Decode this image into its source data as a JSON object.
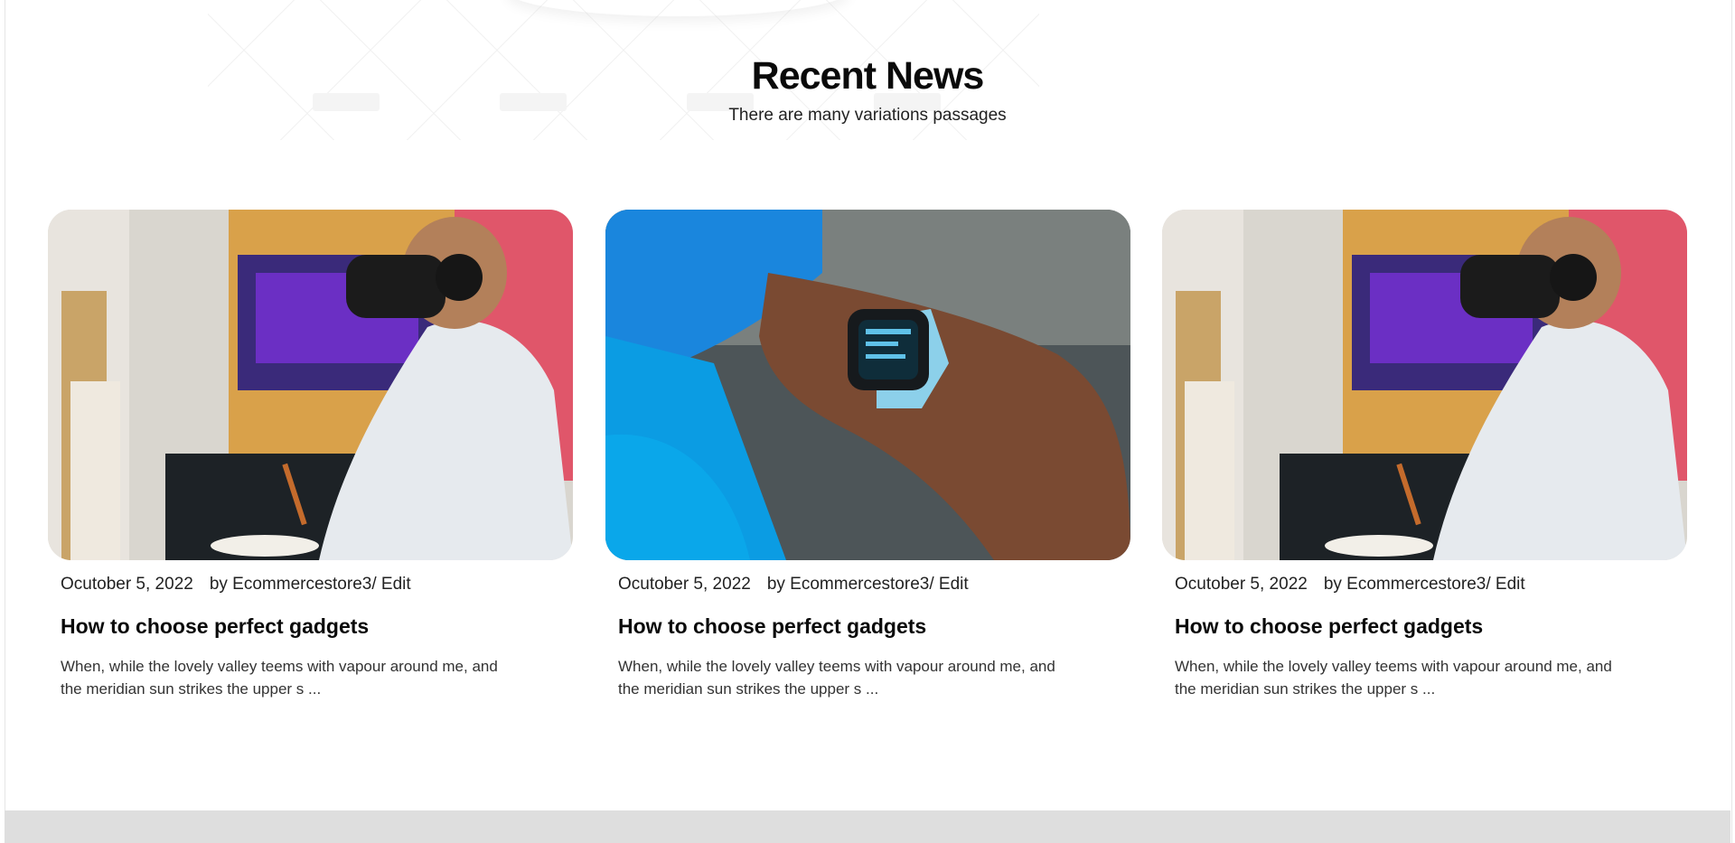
{
  "section": {
    "title": "Recent News",
    "subtitle": "There are many variations passages"
  },
  "posts": [
    {
      "image": "vr-headset-painter-photo",
      "date": "Ocutober 5, 2022",
      "author_line": "by Ecommercestore3/ Edit",
      "title": "How to choose perfect gadgets",
      "excerpt": "When, while the lovely valley teems with vapour around me, and the meridian sun strikes the upper s ..."
    },
    {
      "image": "smartwatch-wrist-photo",
      "date": "Ocutober 5, 2022",
      "author_line": "by Ecommercestore3/ Edit",
      "title": "How to choose perfect gadgets",
      "excerpt": "When, while the lovely valley teems with vapour around me, and the meridian sun strikes the upper s ..."
    },
    {
      "image": "vr-headset-painter-photo",
      "date": "Ocutober 5, 2022",
      "author_line": "by Ecommercestore3/ Edit",
      "title": "How to choose perfect gadgets",
      "excerpt": "When, while the lovely valley teems with vapour around me, and the meridian sun strikes the upper s ..."
    }
  ],
  "colors": {
    "title_text": "#0a0a0a",
    "body_text": "#222222",
    "footer_band": "#dedede"
  }
}
